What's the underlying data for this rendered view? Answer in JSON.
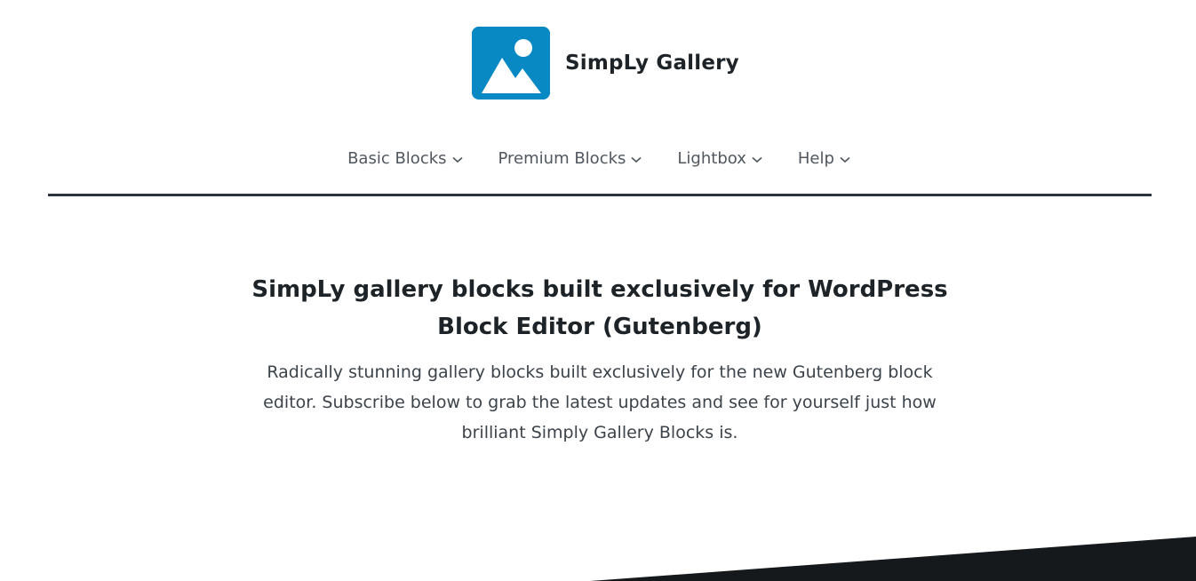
{
  "header": {
    "site_title": "SimpLy Gallery",
    "logo_icon": "image-icon",
    "logo_color": "#0889c4"
  },
  "nav": {
    "items": [
      {
        "label": "Basic Blocks",
        "icon": "chevron-down-icon"
      },
      {
        "label": "Premium Blocks",
        "icon": "chevron-down-icon"
      },
      {
        "label": "Lightbox",
        "icon": "chevron-down-icon"
      },
      {
        "label": "Help",
        "icon": "chevron-down-icon"
      }
    ],
    "rule_color": "#2c3340"
  },
  "hero": {
    "title": "SimpLy gallery blocks built exclusively for WordPress Block Editor (Gutenberg)",
    "text": "Radically stunning gallery blocks built exclusively for the new Gutenberg block editor. Subscribe below to grab the latest updates and see for yourself just how brilliant Simply Gallery Blocks is."
  },
  "decor": {
    "slant_color": "#16191c"
  }
}
